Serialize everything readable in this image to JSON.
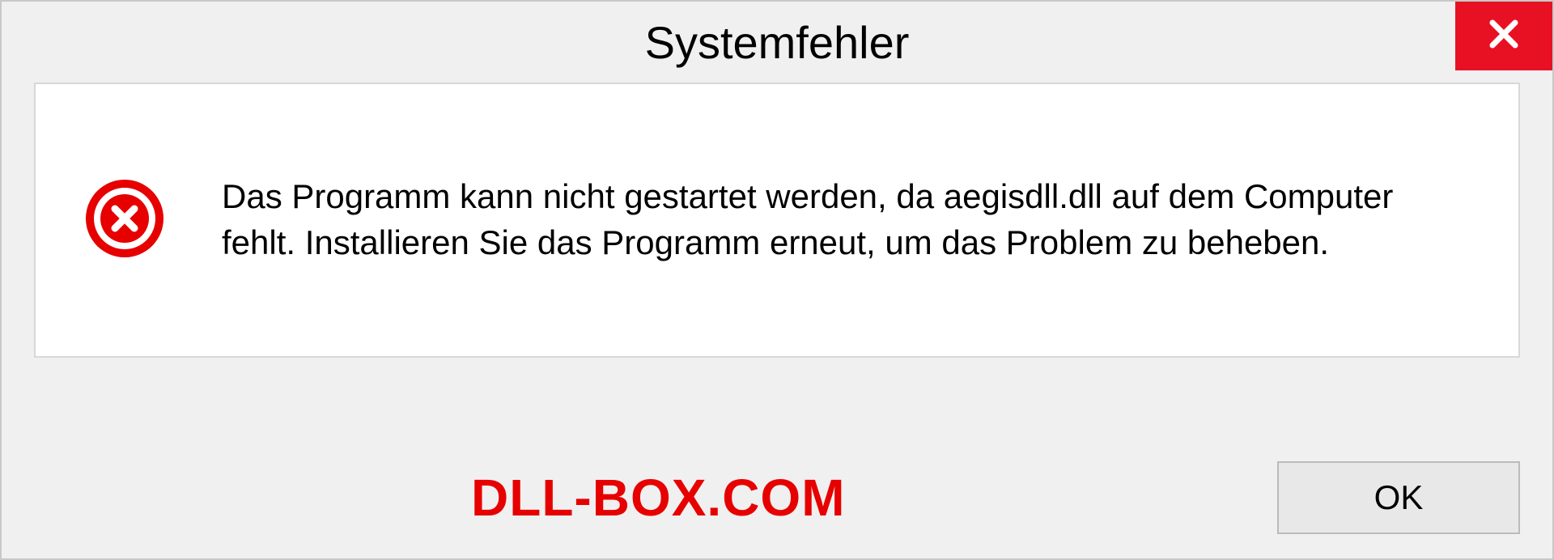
{
  "dialog": {
    "title": "Systemfehler",
    "message": "Das Programm kann nicht gestartet werden, da aegisdll.dll auf dem Computer fehlt. Installieren Sie das Programm erneut, um das Problem zu beheben.",
    "ok_label": "OK"
  },
  "watermark": "DLL-BOX.COM"
}
